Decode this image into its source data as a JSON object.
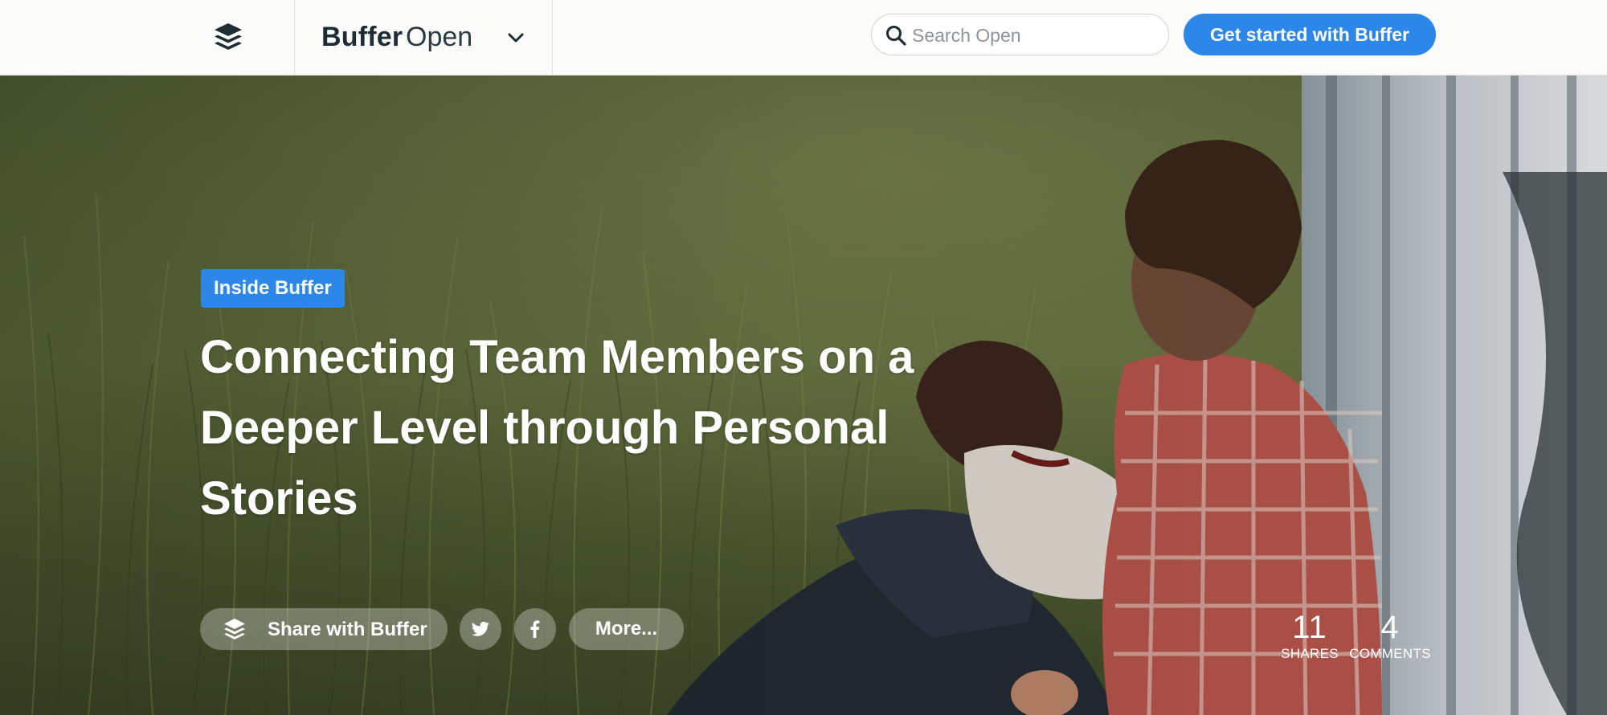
{
  "header": {
    "brand_name": "Buffer",
    "brand_sub": "Open",
    "logo_icon": "buffer-stack-icon",
    "dropdown_icon": "chevron-down-icon",
    "search": {
      "placeholder": "Search Open",
      "value": "",
      "icon": "search-icon"
    },
    "cta_label": "Get started with Buffer",
    "accent_color": "#2c87e8"
  },
  "hero": {
    "category_tag": "Inside Buffer",
    "title": "Connecting Team Members on a Deeper Level through Personal Stories",
    "share": {
      "buffer_label": "Share with Buffer",
      "buffer_icon": "buffer-stack-icon",
      "twitter_icon": "twitter-icon",
      "facebook_icon": "facebook-icon",
      "more_label": "More..."
    },
    "stats": {
      "shares_count": "11",
      "shares_label": "SHARES",
      "comments_count": "4",
      "comments_label": "COMMENTS"
    }
  }
}
